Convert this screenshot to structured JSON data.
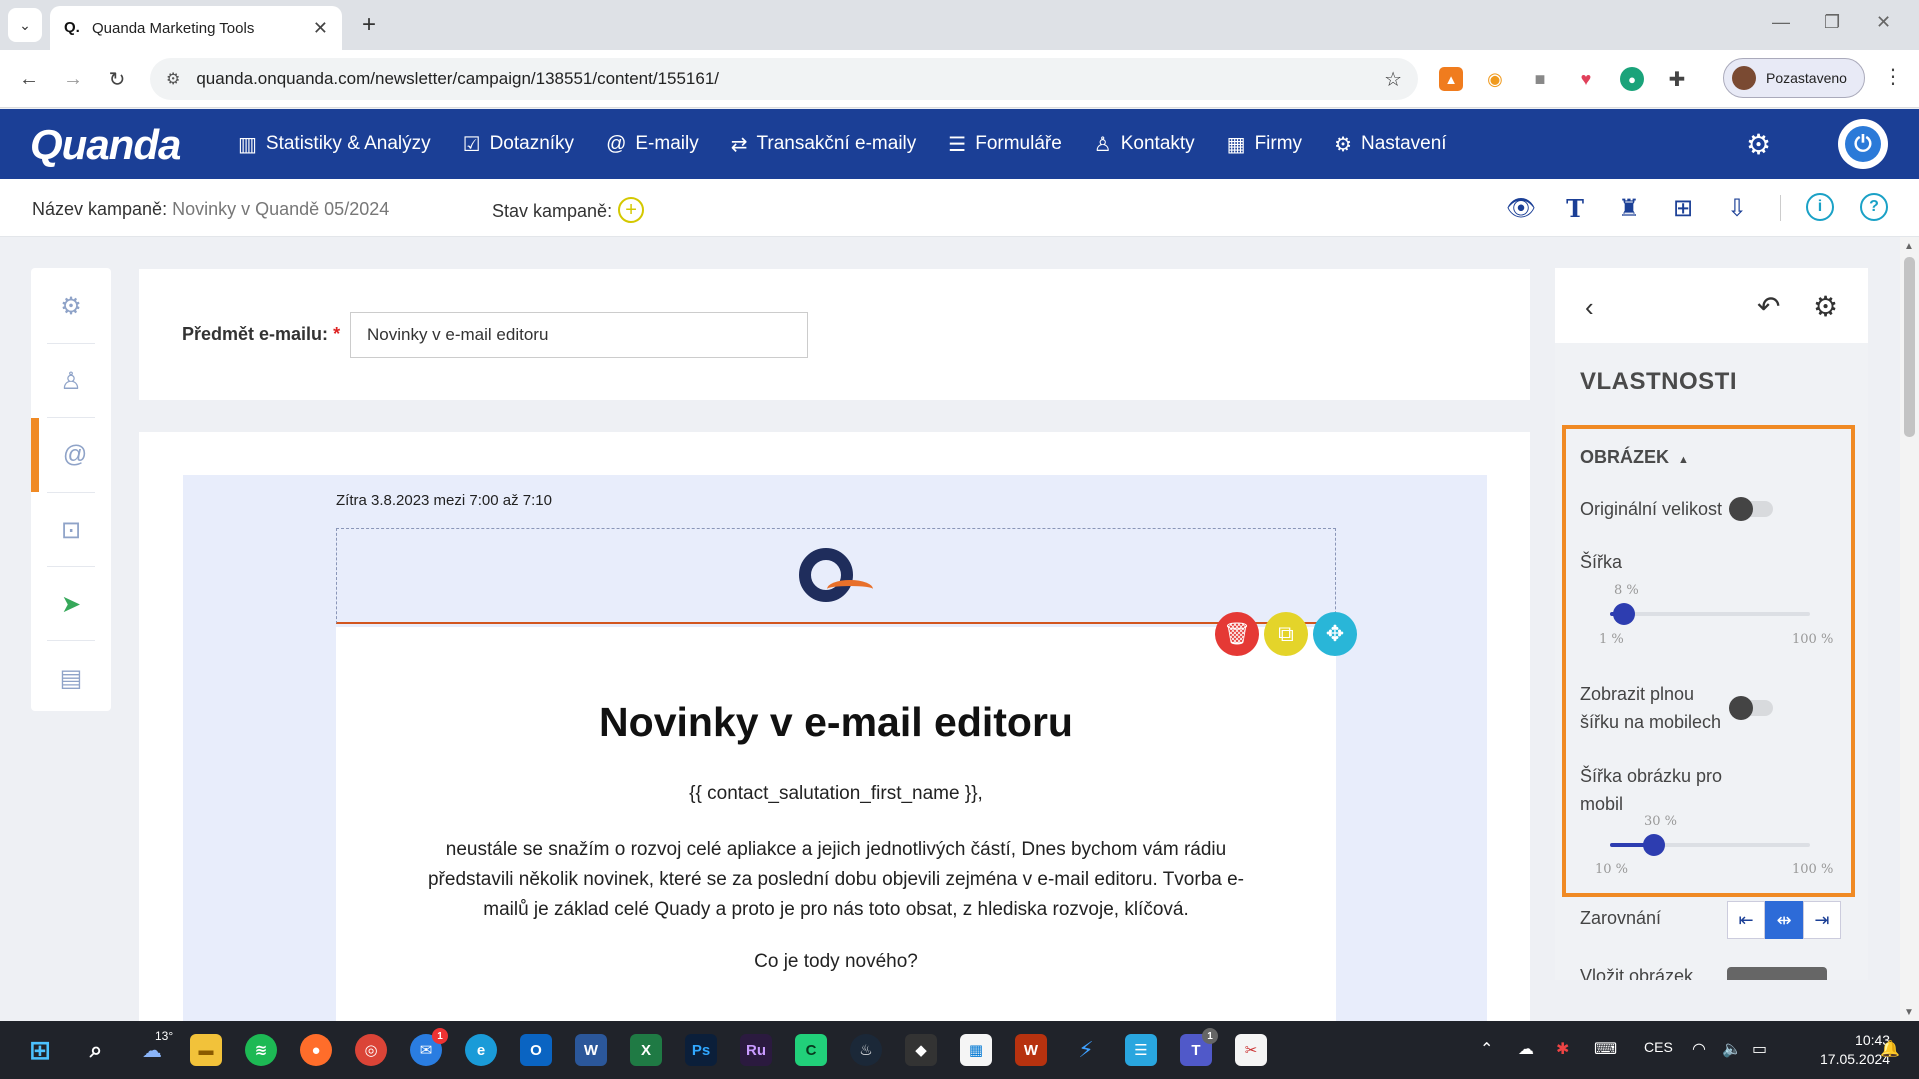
{
  "browser": {
    "tab_title": "Quanda Marketing Tools",
    "url": "quanda.onquanda.com/newsletter/campaign/138551/content/155161/",
    "profile_label": "Pozastaveno"
  },
  "app": {
    "logo": "Quanda",
    "nav": [
      {
        "label": "Statistiky & Analýzy",
        "icon": "bar-chart-icon"
      },
      {
        "label": "Dotazníky",
        "icon": "survey-icon"
      },
      {
        "label": "E-maily",
        "icon": "at-icon"
      },
      {
        "label": "Transakční e-maily",
        "icon": "transaction-icon"
      },
      {
        "label": "Formuláře",
        "icon": "form-icon"
      },
      {
        "label": "Kontakty",
        "icon": "contacts-icon"
      },
      {
        "label": "Firmy",
        "icon": "building-icon"
      },
      {
        "label": "Nastavení",
        "icon": "gear-icon"
      }
    ]
  },
  "campaign": {
    "name_label": "Název kampaně:",
    "name_value": "Novinky v Quandě 05/2024",
    "state_label": "Stav kampaně:"
  },
  "subject": {
    "label": "Předmět e-mailu:",
    "required_mark": "*",
    "value": "Novinky v e-mail editoru"
  },
  "email": {
    "preheader": "Zítra 3.8.2023 mezi 7:00 až 7:10",
    "title": "Novinky v e-mail editoru",
    "salutation": "{{ contact_salutation_first_name }},",
    "paragraph": "neustále se snažím o rozvoj celé apliakce a jejich jednotlivých částí, Dnes bychom vám rádiu představili několik novinek, které se za poslední dobu objevili zejména v e-mail editoru. Tvorba e-mailů je základ celé Quady a proto je pro nás toto obsat, z hlediska rozvoje, klíčová.",
    "question": "Co je tody nového?"
  },
  "panel": {
    "title": "VLASTNOSTI",
    "section": "OBRÁZEK",
    "original_size_label": "Originální velikost",
    "width_label": "Šířka",
    "width_value": 8,
    "width_value_text": "8 %",
    "width_min": "1 %",
    "width_max": "100 %",
    "mobile_full_label_1": "Zobrazit plnou",
    "mobile_full_label_2": "šířku na mobilech",
    "mobile_width_label_1": "Šířka obrázku pro",
    "mobile_width_label_2": "mobil",
    "mobile_width_value": 30,
    "mobile_width_value_text": "30 %",
    "mobile_width_min": "10 %",
    "mobile_width_max": "100 %",
    "align_label": "Zarovnání",
    "insert_label": "Vložit obrázek"
  },
  "taskbar": {
    "temperature": "13°",
    "language": "CES",
    "time": "10:43",
    "date": "17.05.2024"
  },
  "colors": {
    "brand": "#1b3f96",
    "accent_orange": "#f08a24",
    "delete_red": "#e53935",
    "duplicate_yellow": "#e4d42a",
    "move_teal": "#29b6d8"
  }
}
